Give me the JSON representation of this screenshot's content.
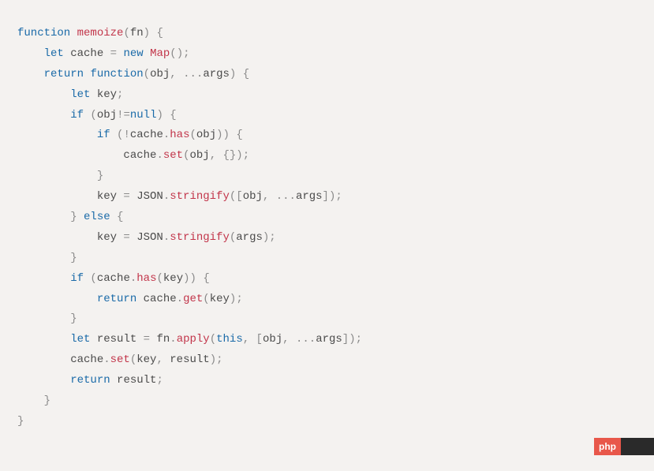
{
  "code": {
    "tokens": [
      [
        {
          "t": "function",
          "c": "kw"
        },
        {
          "t": " "
        },
        {
          "t": "memoize",
          "c": "fn"
        },
        {
          "t": "(",
          "c": "punc"
        },
        {
          "t": "fn",
          "c": "id"
        },
        {
          "t": ")",
          "c": "punc"
        },
        {
          "t": " "
        },
        {
          "t": "{",
          "c": "punc"
        }
      ],
      [
        {
          "t": "    "
        },
        {
          "t": "let",
          "c": "kw"
        },
        {
          "t": " cache "
        },
        {
          "t": "=",
          "c": "punc"
        },
        {
          "t": " "
        },
        {
          "t": "new",
          "c": "kw"
        },
        {
          "t": " "
        },
        {
          "t": "Map",
          "c": "fn"
        },
        {
          "t": "();",
          "c": "punc"
        }
      ],
      [
        {
          "t": "    "
        },
        {
          "t": "return",
          "c": "kw"
        },
        {
          "t": " "
        },
        {
          "t": "function",
          "c": "kw"
        },
        {
          "t": "(",
          "c": "punc"
        },
        {
          "t": "obj"
        },
        {
          "t": ",",
          "c": "punc"
        },
        {
          "t": " "
        },
        {
          "t": "...",
          "c": "punc"
        },
        {
          "t": "args"
        },
        {
          "t": ")",
          "c": "punc"
        },
        {
          "t": " "
        },
        {
          "t": "{",
          "c": "punc"
        }
      ],
      [
        {
          "t": "        "
        },
        {
          "t": "let",
          "c": "kw"
        },
        {
          "t": " key"
        },
        {
          "t": ";",
          "c": "punc"
        }
      ],
      [
        {
          "t": "        "
        },
        {
          "t": "if",
          "c": "kw"
        },
        {
          "t": " (",
          "c": "punc"
        },
        {
          "t": "obj"
        },
        {
          "t": "!=",
          "c": "punc"
        },
        {
          "t": "null",
          "c": "null"
        },
        {
          "t": ")",
          "c": "punc"
        },
        {
          "t": " "
        },
        {
          "t": "{",
          "c": "punc"
        }
      ],
      [
        {
          "t": "            "
        },
        {
          "t": "if",
          "c": "kw"
        },
        {
          "t": " (!",
          "c": "punc"
        },
        {
          "t": "cache"
        },
        {
          "t": ".",
          "c": "punc"
        },
        {
          "t": "has",
          "c": "fn"
        },
        {
          "t": "(",
          "c": "punc"
        },
        {
          "t": "obj"
        },
        {
          "t": "))",
          "c": "punc"
        },
        {
          "t": " "
        },
        {
          "t": "{",
          "c": "punc"
        }
      ],
      [
        {
          "t": "                cache"
        },
        {
          "t": ".",
          "c": "punc"
        },
        {
          "t": "set",
          "c": "fn"
        },
        {
          "t": "(",
          "c": "punc"
        },
        {
          "t": "obj"
        },
        {
          "t": ",",
          "c": "punc"
        },
        {
          "t": " "
        },
        {
          "t": "{});",
          "c": "punc"
        }
      ],
      [
        {
          "t": "            "
        },
        {
          "t": "}",
          "c": "punc"
        }
      ],
      [
        {
          "t": "            key "
        },
        {
          "t": "=",
          "c": "punc"
        },
        {
          "t": " JSON"
        },
        {
          "t": ".",
          "c": "punc"
        },
        {
          "t": "stringify",
          "c": "fn"
        },
        {
          "t": "([",
          "c": "punc"
        },
        {
          "t": "obj"
        },
        {
          "t": ",",
          "c": "punc"
        },
        {
          "t": " "
        },
        {
          "t": "...",
          "c": "punc"
        },
        {
          "t": "args"
        },
        {
          "t": "]);",
          "c": "punc"
        }
      ],
      [
        {
          "t": "        "
        },
        {
          "t": "}",
          "c": "punc"
        },
        {
          "t": " "
        },
        {
          "t": "else",
          "c": "kw"
        },
        {
          "t": " "
        },
        {
          "t": "{",
          "c": "punc"
        }
      ],
      [
        {
          "t": "            key "
        },
        {
          "t": "=",
          "c": "punc"
        },
        {
          "t": " JSON"
        },
        {
          "t": ".",
          "c": "punc"
        },
        {
          "t": "stringify",
          "c": "fn"
        },
        {
          "t": "(",
          "c": "punc"
        },
        {
          "t": "args"
        },
        {
          "t": ");",
          "c": "punc"
        }
      ],
      [
        {
          "t": "        "
        },
        {
          "t": "}",
          "c": "punc"
        }
      ],
      [
        {
          "t": "        "
        },
        {
          "t": "if",
          "c": "kw"
        },
        {
          "t": " (",
          "c": "punc"
        },
        {
          "t": "cache"
        },
        {
          "t": ".",
          "c": "punc"
        },
        {
          "t": "has",
          "c": "fn"
        },
        {
          "t": "(",
          "c": "punc"
        },
        {
          "t": "key"
        },
        {
          "t": "))",
          "c": "punc"
        },
        {
          "t": " "
        },
        {
          "t": "{",
          "c": "punc"
        }
      ],
      [
        {
          "t": "            "
        },
        {
          "t": "return",
          "c": "kw"
        },
        {
          "t": " cache"
        },
        {
          "t": ".",
          "c": "punc"
        },
        {
          "t": "get",
          "c": "fn"
        },
        {
          "t": "(",
          "c": "punc"
        },
        {
          "t": "key"
        },
        {
          "t": ");",
          "c": "punc"
        }
      ],
      [
        {
          "t": "        "
        },
        {
          "t": "}",
          "c": "punc"
        }
      ],
      [
        {
          "t": "        "
        },
        {
          "t": "let",
          "c": "kw"
        },
        {
          "t": " result "
        },
        {
          "t": "=",
          "c": "punc"
        },
        {
          "t": " fn"
        },
        {
          "t": ".",
          "c": "punc"
        },
        {
          "t": "apply",
          "c": "fn"
        },
        {
          "t": "(",
          "c": "punc"
        },
        {
          "t": "this",
          "c": "this"
        },
        {
          "t": ",",
          "c": "punc"
        },
        {
          "t": " "
        },
        {
          "t": "[",
          "c": "punc"
        },
        {
          "t": "obj"
        },
        {
          "t": ",",
          "c": "punc"
        },
        {
          "t": " "
        },
        {
          "t": "...",
          "c": "punc"
        },
        {
          "t": "args"
        },
        {
          "t": "]);",
          "c": "punc"
        }
      ],
      [
        {
          "t": "        cache"
        },
        {
          "t": ".",
          "c": "punc"
        },
        {
          "t": "set",
          "c": "fn"
        },
        {
          "t": "(",
          "c": "punc"
        },
        {
          "t": "key"
        },
        {
          "t": ",",
          "c": "punc"
        },
        {
          "t": " result"
        },
        {
          "t": ");",
          "c": "punc"
        }
      ],
      [
        {
          "t": "        "
        },
        {
          "t": "return",
          "c": "kw"
        },
        {
          "t": " result"
        },
        {
          "t": ";",
          "c": "punc"
        }
      ],
      [
        {
          "t": "    "
        },
        {
          "t": "}",
          "c": "punc"
        }
      ],
      [
        {
          "t": "}",
          "c": "punc"
        }
      ]
    ]
  },
  "watermark": {
    "left": "php",
    "right": ""
  }
}
